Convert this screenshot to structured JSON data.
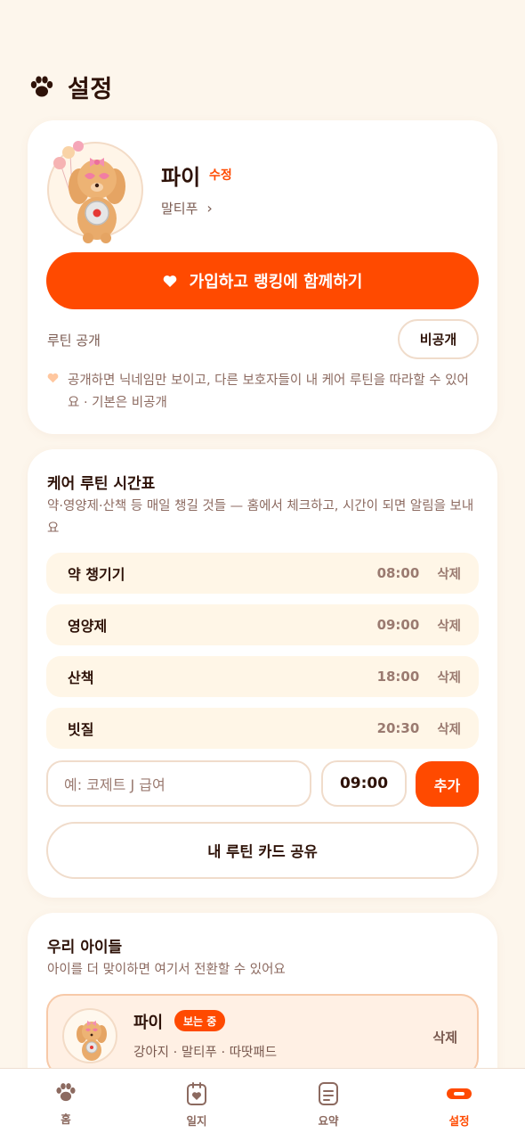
{
  "header": {
    "title": "설정",
    "icon": "paw-icon"
  },
  "profile": {
    "name": "파이",
    "edit_label": "수정",
    "breed": "말티푸",
    "breed_chevron": "›",
    "join_button_label": "가입하고 랭킹에 함께하기",
    "routine_public_label": "루틴 공개",
    "visibility_toggle_label": "비공개",
    "hint": "공개하면 닉네임만 보이고, 다른 보호자들이 내 케어 루틴을 따라할 수 있어요 · 기본은 비공개"
  },
  "routine": {
    "title": "케어 루틴 시간표",
    "description": "약·영양제·산책 등 매일 챙길 것들 — 홈에서 체크하고, 시간이 되면 알림을 보내요",
    "items": [
      {
        "name": "약 챙기기",
        "time": "08:00",
        "delete_label": "삭제"
      },
      {
        "name": "영양제",
        "time": "09:00",
        "delete_label": "삭제"
      },
      {
        "name": "산책",
        "time": "18:00",
        "delete_label": "삭제"
      },
      {
        "name": "빗질",
        "time": "20:30",
        "delete_label": "삭제"
      }
    ],
    "new_item_placeholder": "예: 코제트 J 급여",
    "new_item_time": "09:00",
    "add_button_label": "추가",
    "share_button_label": "내 루틴 카드 공유"
  },
  "kids": {
    "title": "우리 아이들",
    "description": "아이를 더 맞이하면 여기서 전환할 수 있어요",
    "items": [
      {
        "name": "파이",
        "badge": "보는 중",
        "meta": "강아지 · 말티푸 · 따땃패드",
        "delete_label": "삭제"
      }
    ]
  },
  "nav": {
    "items": [
      {
        "label": "홈",
        "icon": "paw-icon"
      },
      {
        "label": "일지",
        "icon": "journal-heart-icon"
      },
      {
        "label": "요약",
        "icon": "summary-doc-icon"
      },
      {
        "label": "설정",
        "icon": "settings-pill-icon",
        "active": true
      }
    ]
  },
  "colors": {
    "accent": "#FF4A00",
    "background": "#FDF6EC",
    "card": "#FFFFFF",
    "row_fill": "#FFF6E7",
    "text_primary": "#2E1208",
    "text_muted": "#8C6A60"
  }
}
